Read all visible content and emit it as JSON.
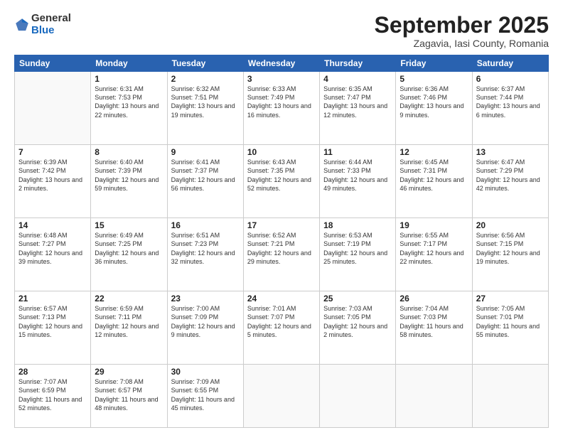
{
  "header": {
    "logo_general": "General",
    "logo_blue": "Blue",
    "title": "September 2025",
    "location": "Zagavia, Iasi County, Romania"
  },
  "days_of_week": [
    "Sunday",
    "Monday",
    "Tuesday",
    "Wednesday",
    "Thursday",
    "Friday",
    "Saturday"
  ],
  "weeks": [
    [
      {
        "day": "",
        "info": ""
      },
      {
        "day": "1",
        "info": "Sunrise: 6:31 AM\nSunset: 7:53 PM\nDaylight: 13 hours\nand 22 minutes."
      },
      {
        "day": "2",
        "info": "Sunrise: 6:32 AM\nSunset: 7:51 PM\nDaylight: 13 hours\nand 19 minutes."
      },
      {
        "day": "3",
        "info": "Sunrise: 6:33 AM\nSunset: 7:49 PM\nDaylight: 13 hours\nand 16 minutes."
      },
      {
        "day": "4",
        "info": "Sunrise: 6:35 AM\nSunset: 7:47 PM\nDaylight: 13 hours\nand 12 minutes."
      },
      {
        "day": "5",
        "info": "Sunrise: 6:36 AM\nSunset: 7:46 PM\nDaylight: 13 hours\nand 9 minutes."
      },
      {
        "day": "6",
        "info": "Sunrise: 6:37 AM\nSunset: 7:44 PM\nDaylight: 13 hours\nand 6 minutes."
      }
    ],
    [
      {
        "day": "7",
        "info": "Sunrise: 6:39 AM\nSunset: 7:42 PM\nDaylight: 13 hours\nand 2 minutes."
      },
      {
        "day": "8",
        "info": "Sunrise: 6:40 AM\nSunset: 7:39 PM\nDaylight: 12 hours\nand 59 minutes."
      },
      {
        "day": "9",
        "info": "Sunrise: 6:41 AM\nSunset: 7:37 PM\nDaylight: 12 hours\nand 56 minutes."
      },
      {
        "day": "10",
        "info": "Sunrise: 6:43 AM\nSunset: 7:35 PM\nDaylight: 12 hours\nand 52 minutes."
      },
      {
        "day": "11",
        "info": "Sunrise: 6:44 AM\nSunset: 7:33 PM\nDaylight: 12 hours\nand 49 minutes."
      },
      {
        "day": "12",
        "info": "Sunrise: 6:45 AM\nSunset: 7:31 PM\nDaylight: 12 hours\nand 46 minutes."
      },
      {
        "day": "13",
        "info": "Sunrise: 6:47 AM\nSunset: 7:29 PM\nDaylight: 12 hours\nand 42 minutes."
      }
    ],
    [
      {
        "day": "14",
        "info": "Sunrise: 6:48 AM\nSunset: 7:27 PM\nDaylight: 12 hours\nand 39 minutes."
      },
      {
        "day": "15",
        "info": "Sunrise: 6:49 AM\nSunset: 7:25 PM\nDaylight: 12 hours\nand 36 minutes."
      },
      {
        "day": "16",
        "info": "Sunrise: 6:51 AM\nSunset: 7:23 PM\nDaylight: 12 hours\nand 32 minutes."
      },
      {
        "day": "17",
        "info": "Sunrise: 6:52 AM\nSunset: 7:21 PM\nDaylight: 12 hours\nand 29 minutes."
      },
      {
        "day": "18",
        "info": "Sunrise: 6:53 AM\nSunset: 7:19 PM\nDaylight: 12 hours\nand 25 minutes."
      },
      {
        "day": "19",
        "info": "Sunrise: 6:55 AM\nSunset: 7:17 PM\nDaylight: 12 hours\nand 22 minutes."
      },
      {
        "day": "20",
        "info": "Sunrise: 6:56 AM\nSunset: 7:15 PM\nDaylight: 12 hours\nand 19 minutes."
      }
    ],
    [
      {
        "day": "21",
        "info": "Sunrise: 6:57 AM\nSunset: 7:13 PM\nDaylight: 12 hours\nand 15 minutes."
      },
      {
        "day": "22",
        "info": "Sunrise: 6:59 AM\nSunset: 7:11 PM\nDaylight: 12 hours\nand 12 minutes."
      },
      {
        "day": "23",
        "info": "Sunrise: 7:00 AM\nSunset: 7:09 PM\nDaylight: 12 hours\nand 9 minutes."
      },
      {
        "day": "24",
        "info": "Sunrise: 7:01 AM\nSunset: 7:07 PM\nDaylight: 12 hours\nand 5 minutes."
      },
      {
        "day": "25",
        "info": "Sunrise: 7:03 AM\nSunset: 7:05 PM\nDaylight: 12 hours\nand 2 minutes."
      },
      {
        "day": "26",
        "info": "Sunrise: 7:04 AM\nSunset: 7:03 PM\nDaylight: 11 hours\nand 58 minutes."
      },
      {
        "day": "27",
        "info": "Sunrise: 7:05 AM\nSunset: 7:01 PM\nDaylight: 11 hours\nand 55 minutes."
      }
    ],
    [
      {
        "day": "28",
        "info": "Sunrise: 7:07 AM\nSunset: 6:59 PM\nDaylight: 11 hours\nand 52 minutes."
      },
      {
        "day": "29",
        "info": "Sunrise: 7:08 AM\nSunset: 6:57 PM\nDaylight: 11 hours\nand 48 minutes."
      },
      {
        "day": "30",
        "info": "Sunrise: 7:09 AM\nSunset: 6:55 PM\nDaylight: 11 hours\nand 45 minutes."
      },
      {
        "day": "",
        "info": ""
      },
      {
        "day": "",
        "info": ""
      },
      {
        "day": "",
        "info": ""
      },
      {
        "day": "",
        "info": ""
      }
    ]
  ]
}
